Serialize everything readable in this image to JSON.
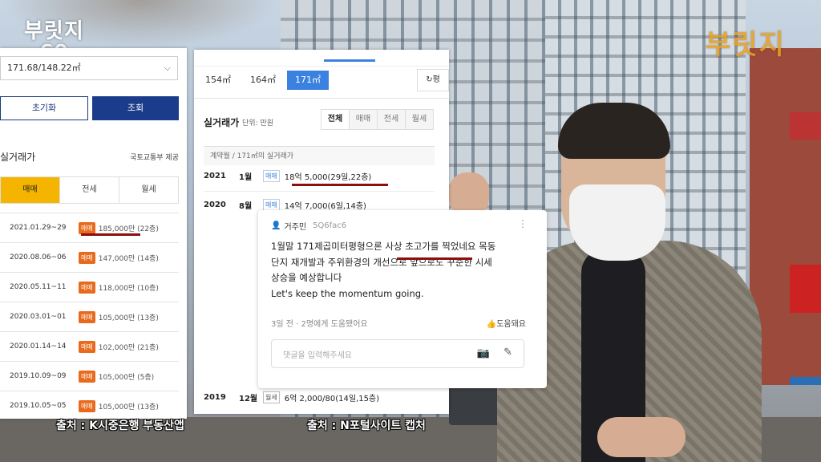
{
  "logos": {
    "left": "부릿지",
    "left_sub": "GO",
    "right": "부릿지"
  },
  "bank_app": {
    "select_value": "171.68/148.22㎡",
    "reset_label": "초기화",
    "search_label": "조회",
    "section_title": "실거래가",
    "section_source": "국토교통부 제공",
    "tabs": [
      "매매",
      "전세",
      "월세"
    ],
    "rows": [
      {
        "date": "2021.01.29~29",
        "badge": "매매",
        "price": "185,000만 (22층)"
      },
      {
        "date": "2020.08.06~06",
        "badge": "매매",
        "price": "147,000만 (14층)"
      },
      {
        "date": "2020.05.11~11",
        "badge": "매매",
        "price": "118,000만 (10층)"
      },
      {
        "date": "2020.03.01~01",
        "badge": "매매",
        "price": "105,000만 (13층)"
      },
      {
        "date": "2020.01.14~14",
        "badge": "매매",
        "price": "102,000만 (21층)"
      },
      {
        "date": "2019.10.09~09",
        "badge": "매매",
        "price": "105,000만 (5층)"
      },
      {
        "date": "2019.10.05~05",
        "badge": "매매",
        "price": "105,000만 (13층)"
      }
    ],
    "caption": "출처 : K시중은행 부동산앱"
  },
  "portal": {
    "areas": [
      "154㎡",
      "164㎡",
      "171㎡"
    ],
    "refresh_label": "평",
    "title": "실거래가",
    "unit": "단위: 만원",
    "filter_tabs": [
      "전체",
      "매매",
      "전세",
      "월세"
    ],
    "subhead": "계약월 / 171㎡의 실거래가",
    "rows": [
      {
        "year": "2021",
        "month": "1월",
        "badge": "매매",
        "text": "18억 5,000(29일,22층)"
      },
      {
        "year": "2020",
        "month": "8월",
        "badge": "매매",
        "text": "14억 7,000(6일,14층)"
      },
      {
        "year": "2019",
        "month": "12월",
        "badge": "월세",
        "text": "6억 2,000/80(14일,15층)"
      }
    ],
    "caption": "출처 : N포털사이트 캡처"
  },
  "comment": {
    "user": "거주민",
    "user_id": "5Q6fac6",
    "line1": "1월말 171제곱미터평형으론 사상 초고가를 찍었네요 목동",
    "line2": "단지 재개발과 주위환경의 개선으로 앞으로도 꾸준한 시세",
    "line3": "상승을 예상합니다",
    "line4": "Let's keep the momentum going.",
    "meta": "3일 전 · 2명에게 도움됐어요",
    "helpful": "도움돼요",
    "reply_placeholder": "댓글을 입력해주세요"
  },
  "colors": {
    "accent_blue": "#3b82e0",
    "bank_navy": "#1b3c8a",
    "bank_yellow": "#f4b400",
    "badge_orange": "#e86a1d",
    "underline_red": "#8b0f0f"
  }
}
